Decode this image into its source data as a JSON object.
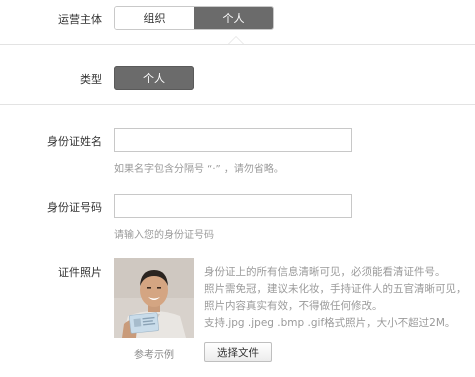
{
  "operator": {
    "label": "运营主体",
    "options": [
      "组织",
      "个人"
    ],
    "selected": "个人"
  },
  "type": {
    "label": "类型",
    "value": "个人"
  },
  "name_field": {
    "label": "身份证姓名",
    "value": "",
    "hint": "如果名字包含分隔号 “·” ，请勿省略。"
  },
  "id_field": {
    "label": "身份证号码",
    "value": "",
    "hint": "请输入您的身份证号码"
  },
  "photo": {
    "label": "证件照片",
    "sample_caption": "参考示例",
    "info": [
      "身份证上的所有信息清晰可见，必须能看清证件号。",
      "照片需免冠，建议未化妆，手持证件人的五官清晰可见，",
      "照片内容真实有效，不得做任何修改。",
      "支持.jpg .jpeg .bmp .gif格式照片，大小不超过2M。"
    ],
    "upload_button": "选择文件"
  }
}
